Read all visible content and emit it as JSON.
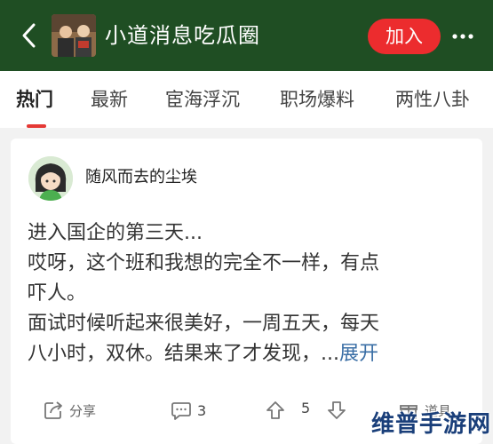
{
  "header": {
    "back_icon": "chevron-left-icon",
    "group_title": "小道消息吃瓜圈",
    "join_label": "加入",
    "more_icon": "more-horizontal-icon",
    "accent_color": "#1f4e23",
    "join_color": "#ec2c2e"
  },
  "tabs": [
    {
      "label": "热门",
      "active": true
    },
    {
      "label": "最新"
    },
    {
      "label": "宦海浮沉"
    },
    {
      "label": "职场爆料"
    },
    {
      "label": "两性八卦"
    }
  ],
  "post": {
    "author": "随风而去的尘埃",
    "lines": [
      "进入国企的第三天...",
      "哎呀，这个班和我想的完全不一样，有点",
      "吓人。",
      "面试时候听起来很美好，一周五天，每天",
      "八小时，双休。结果来了才发现，..."
    ],
    "expand_label": "展开",
    "actions": {
      "share_label": "分享",
      "comment_count": "3",
      "vote_count": "5",
      "tool_label": "道具"
    }
  },
  "watermark": "维普手游网"
}
